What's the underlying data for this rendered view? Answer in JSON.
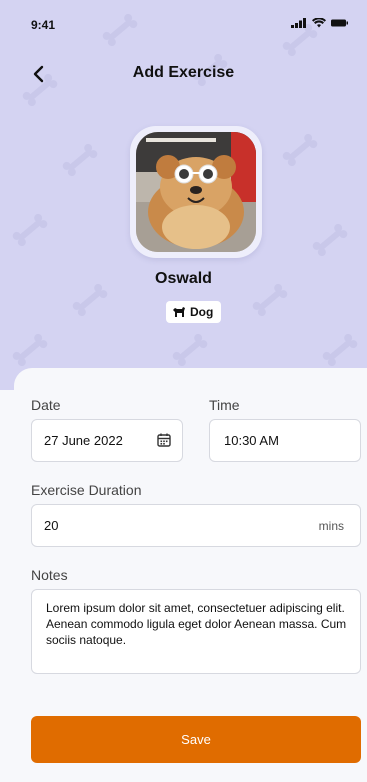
{
  "status_bar": {
    "time": "9:41"
  },
  "header": {
    "title": "Add Exercise",
    "back_icon": "chevron-left-icon"
  },
  "pet": {
    "name": "Oswald",
    "species": "Dog",
    "species_icon": "dog-icon"
  },
  "form": {
    "date_label": "Date",
    "date_value": "27 June 2022",
    "time_label": "Time",
    "time_value": "10:30 AM",
    "duration_label": "Exercise Duration",
    "duration_value": "20",
    "duration_unit": "mins",
    "notes_label": "Notes",
    "notes_value": "Lorem ipsum dolor sit amet, consectetuer adipiscing elit. Aenean commodo ligula eget dolor Aenean massa. Cum sociis natoque."
  },
  "actions": {
    "save_label": "Save"
  },
  "colors": {
    "header_bg": "#d4d3f2",
    "accent": "#e06c00"
  }
}
